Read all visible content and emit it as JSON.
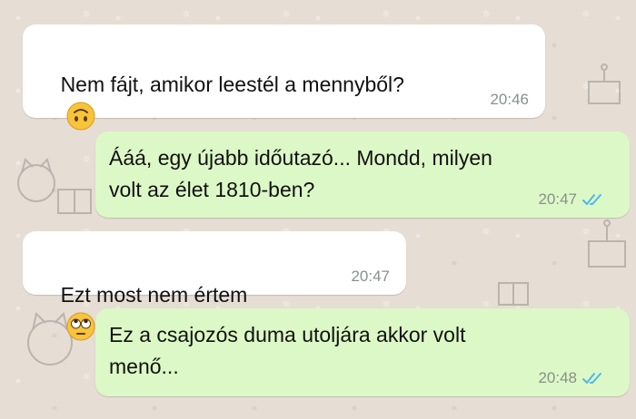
{
  "chat": {
    "messages": [
      {
        "direction": "incoming",
        "text": "Nem fájt, amikor leestél a mennyből?",
        "emoji": "upside-down-face",
        "time": "20:46"
      },
      {
        "direction": "outgoing",
        "text_line1": "Ááá, egy újabb időutazó... Mondd, milyen",
        "text_line2": "volt az élet 1810-ben?",
        "time": "20:47",
        "status": "read"
      },
      {
        "direction": "incoming",
        "text": "Ezt most nem értem",
        "emoji": "face-with-rolling-eyes",
        "time": "20:47"
      },
      {
        "direction": "outgoing",
        "text_line1": "Ez a csajozós duma utoljára akkor volt",
        "text_line2": "menő...",
        "time": "20:48",
        "status": "read"
      }
    ]
  },
  "colors": {
    "wallpaper": "#e6ddd4",
    "incoming_bubble": "#ffffff",
    "outgoing_bubble": "#dcf8c6",
    "read_ticks": "#4fb6ec",
    "timestamp": "#8a8f8c"
  }
}
